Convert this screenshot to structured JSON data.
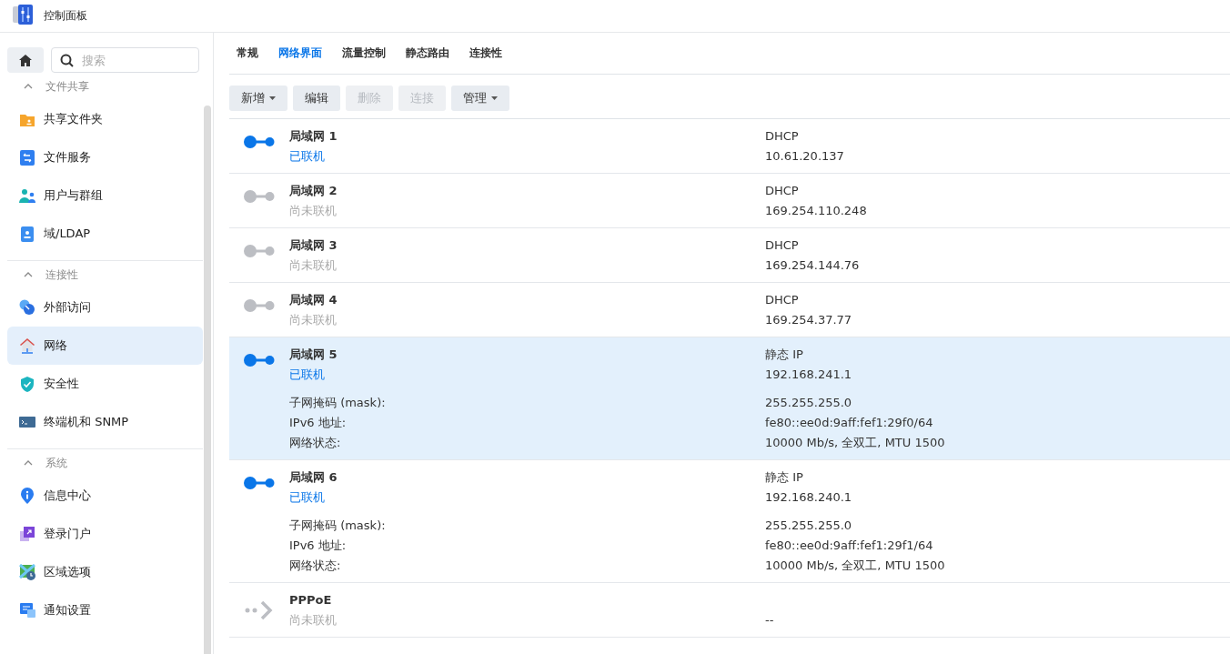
{
  "window": {
    "title": "控制面板"
  },
  "sidebar": {
    "search": {
      "placeholder": "搜索"
    },
    "groups": [
      {
        "title": "文件共享",
        "expanded": true,
        "items": [
          {
            "label": "共享文件夹",
            "selected": false
          },
          {
            "label": "文件服务",
            "selected": false
          },
          {
            "label": "用户与群组",
            "selected": false
          },
          {
            "label": "域/LDAP",
            "selected": false
          }
        ]
      },
      {
        "title": "连接性",
        "expanded": true,
        "items": [
          {
            "label": "外部访问",
            "selected": false
          },
          {
            "label": "网络",
            "selected": true
          },
          {
            "label": "安全性",
            "selected": false
          },
          {
            "label": "终端机和 SNMP",
            "selected": false
          }
        ]
      },
      {
        "title": "系统",
        "expanded": true,
        "items": [
          {
            "label": "信息中心",
            "selected": false
          },
          {
            "label": "登录门户",
            "selected": false
          },
          {
            "label": "区域选项",
            "selected": false
          },
          {
            "label": "通知设置",
            "selected": false
          }
        ]
      }
    ]
  },
  "tabs": [
    {
      "label": "常规",
      "selected": false
    },
    {
      "label": "网络界面",
      "selected": true
    },
    {
      "label": "流量控制",
      "selected": false
    },
    {
      "label": "静态路由",
      "selected": false
    },
    {
      "label": "连接性",
      "selected": false
    }
  ],
  "toolbar": [
    {
      "label": "新增",
      "dropdown": true,
      "disabled": false
    },
    {
      "label": "编辑",
      "dropdown": false,
      "disabled": false
    },
    {
      "label": "删除",
      "dropdown": false,
      "disabled": true
    },
    {
      "label": "连接",
      "dropdown": false,
      "disabled": true
    },
    {
      "label": "管理",
      "dropdown": true,
      "disabled": false
    }
  ],
  "interfaces": [
    {
      "kind": "lan",
      "name": "局域网 1",
      "status": "已联机",
      "connected": true,
      "selected": false,
      "mode": "DHCP",
      "address": "10.61.20.137"
    },
    {
      "kind": "lan",
      "name": "局域网 2",
      "status": "尚未联机",
      "connected": false,
      "selected": false,
      "mode": "DHCP",
      "address": "169.254.110.248"
    },
    {
      "kind": "lan",
      "name": "局域网 3",
      "status": "尚未联机",
      "connected": false,
      "selected": false,
      "mode": "DHCP",
      "address": "169.254.144.76"
    },
    {
      "kind": "lan",
      "name": "局域网 4",
      "status": "尚未联机",
      "connected": false,
      "selected": false,
      "mode": "DHCP",
      "address": "169.254.37.77"
    },
    {
      "kind": "lan",
      "name": "局域网 5",
      "status": "已联机",
      "connected": true,
      "selected": true,
      "mode": "静态 IP",
      "address": "192.168.241.1",
      "details": [
        {
          "label": "子网掩码 (mask):",
          "value": "255.255.255.0"
        },
        {
          "label": "IPv6 地址:",
          "value": "fe80::ee0d:9aff:fef1:29f0/64"
        },
        {
          "label": "网络状态:",
          "value": "10000 Mb/s, 全双工, MTU 1500"
        }
      ]
    },
    {
      "kind": "lan",
      "name": "局域网 6",
      "status": "已联机",
      "connected": true,
      "selected": false,
      "mode": "静态 IP",
      "address": "192.168.240.1",
      "details": [
        {
          "label": "子网掩码 (mask):",
          "value": "255.255.255.0"
        },
        {
          "label": "IPv6 地址:",
          "value": "fe80::ee0d:9aff:fef1:29f1/64"
        },
        {
          "label": "网络状态:",
          "value": "10000 Mb/s, 全双工, MTU 1500"
        }
      ]
    },
    {
      "kind": "pppoe",
      "name": "PPPoE",
      "status": "尚未联机",
      "connected": false,
      "selected": false,
      "address": "--"
    }
  ]
}
